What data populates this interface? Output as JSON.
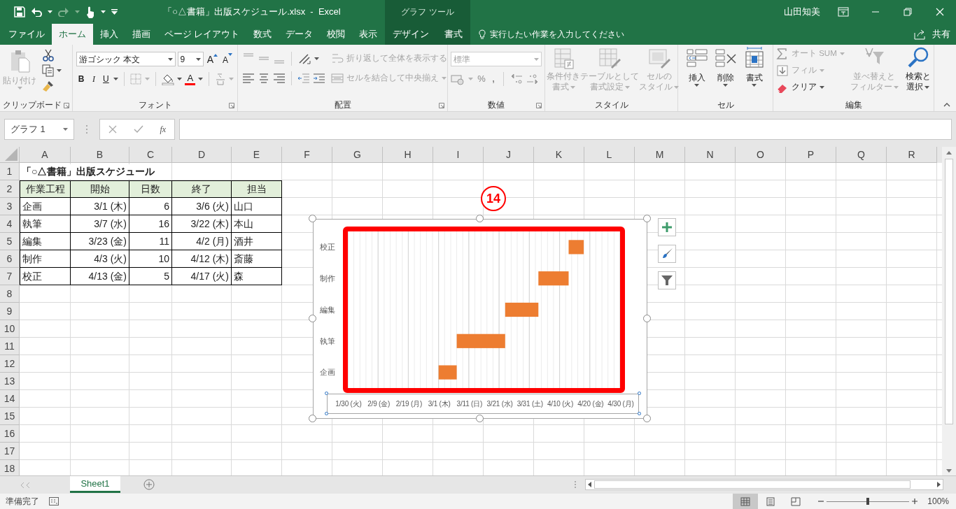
{
  "title_bar": {
    "title": "「○△書籍」出版スケジュール.xlsx  -  Excel",
    "context_label": "グラフ ツール",
    "user": "山田知美"
  },
  "tabs": [
    {
      "label": "ファイル",
      "selected": false,
      "contextual": false
    },
    {
      "label": "ホーム",
      "selected": true,
      "contextual": false
    },
    {
      "label": "挿入",
      "selected": false,
      "contextual": false
    },
    {
      "label": "描画",
      "selected": false,
      "contextual": false
    },
    {
      "label": "ページ レイアウト",
      "selected": false,
      "contextual": false
    },
    {
      "label": "数式",
      "selected": false,
      "contextual": false
    },
    {
      "label": "データ",
      "selected": false,
      "contextual": false
    },
    {
      "label": "校閲",
      "selected": false,
      "contextual": false
    },
    {
      "label": "表示",
      "selected": false,
      "contextual": false
    },
    {
      "label": "デザイン",
      "selected": false,
      "contextual": true
    },
    {
      "label": "書式",
      "selected": false,
      "contextual": true
    }
  ],
  "tell_me": {
    "placeholder": "実行したい作業を入力してください"
  },
  "share": "共有",
  "ribbon": {
    "groups": [
      {
        "kind": "clipboard",
        "label": "クリップボード",
        "paste": {
          "label": "貼り付け",
          "disabled": true
        }
      },
      {
        "kind": "font",
        "label": "フォント",
        "font_name": "游ゴシック 本文",
        "font_size": "9",
        "grow_font": "A",
        "shrink_font": "A",
        "bold": "B",
        "italic": "I",
        "underline": "U",
        "font_color": "A"
      },
      {
        "kind": "alignment",
        "label": "配置",
        "wrap": {
          "label": "折り返して全体を表示する",
          "disabled": true
        },
        "merge": {
          "label": "セルを結合して中央揃え",
          "disabled": true
        }
      },
      {
        "kind": "number",
        "label": "数値",
        "format": {
          "value": "標準",
          "disabled": true
        },
        "percent": "%",
        "comma": ","
      },
      {
        "kind": "styles",
        "label": "スタイル",
        "buttons": [
          {
            "lines": [
              "条件付き",
              "書式"
            ],
            "disabled": true
          },
          {
            "lines": [
              "テーブルとして",
              "書式設定"
            ],
            "disabled": true
          },
          {
            "lines": [
              "セルの",
              "スタイル"
            ],
            "disabled": true
          }
        ]
      },
      {
        "kind": "cells",
        "label": "セル",
        "buttons": [
          {
            "label": "挿入",
            "disabled": false
          },
          {
            "label": "削除",
            "disabled": false
          },
          {
            "label": "書式",
            "disabled": false
          }
        ]
      },
      {
        "kind": "editing",
        "label": "編集",
        "small": [
          {
            "label": "オート SUM",
            "disabled": true
          },
          {
            "label": "フィル",
            "disabled": true
          },
          {
            "label": "クリア",
            "disabled": false
          }
        ],
        "big": [
          {
            "lines": [
              "並べ替えと",
              "フィルター"
            ],
            "disabled": true
          },
          {
            "lines": [
              "検索と",
              "選択"
            ],
            "disabled": false
          }
        ]
      }
    ]
  },
  "formula_bar": {
    "name_box": "グラフ 1",
    "fx": "fx"
  },
  "sheet": {
    "columns": [
      "A",
      "B",
      "C",
      "D",
      "E",
      "F",
      "G",
      "H",
      "I",
      "J",
      "K",
      "L",
      "M",
      "N",
      "O",
      "P",
      "Q",
      "R"
    ],
    "rows": [
      {
        "number": "1",
        "kind": "title",
        "cells": [
          "「○△書籍」出版スケジュール"
        ]
      },
      {
        "number": "2",
        "kind": "header",
        "cells": [
          "作業工程",
          "開始",
          "日数",
          "終了",
          "担当"
        ]
      },
      {
        "number": "3",
        "kind": "data",
        "cells": [
          "企画",
          "3/1 (木)",
          "6",
          "3/6 (火)",
          "山口"
        ]
      },
      {
        "number": "4",
        "kind": "data",
        "cells": [
          "執筆",
          "3/7 (水)",
          "16",
          "3/22 (木)",
          "本山"
        ]
      },
      {
        "number": "5",
        "kind": "data",
        "cells": [
          "編集",
          "3/23 (金)",
          "11",
          "4/2 (月)",
          "酒井"
        ]
      },
      {
        "number": "6",
        "kind": "data",
        "cells": [
          "制作",
          "4/3 (火)",
          "10",
          "4/12 (木)",
          "斎藤"
        ]
      },
      {
        "number": "7",
        "kind": "data",
        "cells": [
          "校正",
          "4/13 (金)",
          "5",
          "4/17 (火)",
          "森"
        ]
      },
      {
        "number": "8",
        "kind": "empty",
        "cells": []
      },
      {
        "number": "9",
        "kind": "empty",
        "cells": []
      },
      {
        "number": "10",
        "kind": "empty",
        "cells": []
      },
      {
        "number": "11",
        "kind": "empty",
        "cells": []
      },
      {
        "number": "12",
        "kind": "empty",
        "cells": []
      },
      {
        "number": "13",
        "kind": "empty",
        "cells": []
      },
      {
        "number": "14",
        "kind": "empty",
        "cells": []
      },
      {
        "number": "15",
        "kind": "empty",
        "cells": []
      },
      {
        "number": "16",
        "kind": "empty",
        "cells": []
      },
      {
        "number": "17",
        "kind": "empty",
        "cells": []
      },
      {
        "number": "18",
        "kind": "empty",
        "cells": []
      }
    ]
  },
  "step_badge": "14",
  "chart": {
    "categories": [
      "校正",
      "制作",
      "編集",
      "執筆",
      "企画"
    ],
    "axis_labels": [
      "1/30 (火)",
      "2/9 (金)",
      "2/19 (月)",
      "3/1 (木)",
      "3/11 (日)",
      "3/21 (水)",
      "3/31 (土)",
      "4/10 (火)",
      "4/20 (金)",
      "4/30 (月)"
    ]
  },
  "sheet_tabs": [
    {
      "label": "Sheet1",
      "selected": true
    }
  ],
  "status_bar": {
    "status": "準備完了",
    "views": [
      {
        "kind": "normal",
        "selected": true
      },
      {
        "kind": "page_layout",
        "selected": false
      },
      {
        "kind": "page_break",
        "selected": false
      }
    ],
    "zoom_slider": {
      "level": 0.5
    },
    "zoom": "100%"
  }
}
